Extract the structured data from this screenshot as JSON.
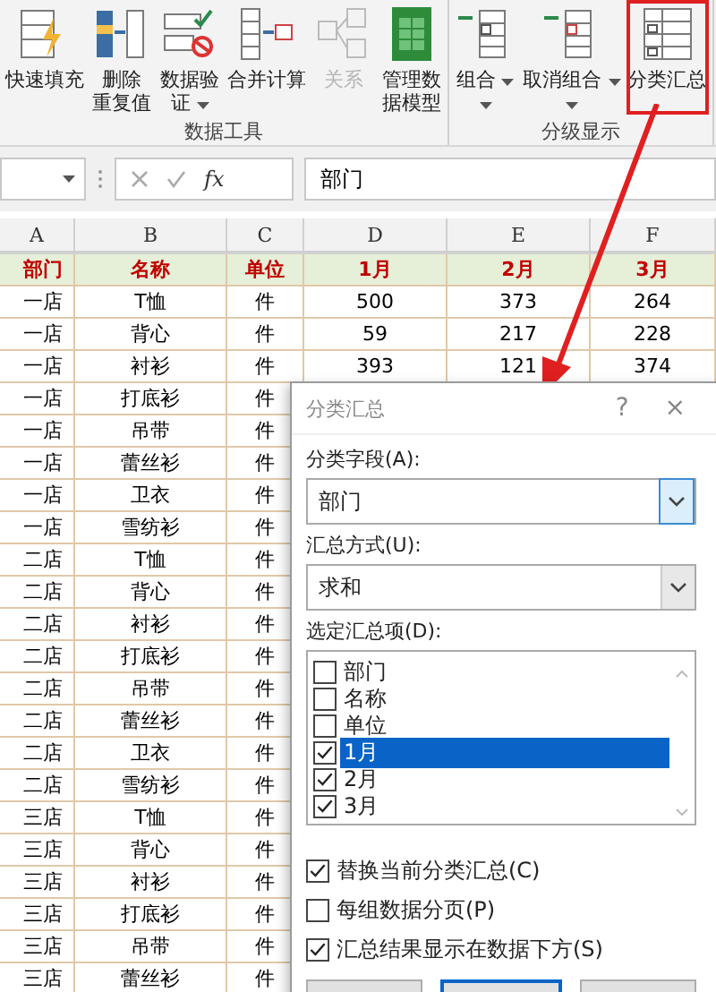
{
  "ribbon": {
    "groups": [
      {
        "label": "数据工具",
        "buttons": [
          {
            "lines": [
              "快速填充"
            ],
            "disabled": false,
            "dropdown": false,
            "annotated": false
          },
          {
            "lines": [
              "删除",
              "重复值"
            ],
            "disabled": false,
            "dropdown": false,
            "annotated": false
          },
          {
            "lines": [
              "数据验",
              "证"
            ],
            "disabled": false,
            "dropdown": true,
            "annotated": false
          },
          {
            "lines": [
              "合并计算"
            ],
            "disabled": false,
            "dropdown": false,
            "annotated": false
          },
          {
            "lines": [
              "关系"
            ],
            "disabled": true,
            "dropdown": false,
            "annotated": false
          },
          {
            "lines": [
              "管理数",
              "据模型"
            ],
            "disabled": false,
            "dropdown": false,
            "annotated": false
          }
        ]
      },
      {
        "label": "分级显示",
        "buttons": [
          {
            "lines": [
              "组合"
            ],
            "disabled": false,
            "dropdown": true,
            "annotated": false
          },
          {
            "lines": [
              "取消组合"
            ],
            "disabled": false,
            "dropdown": true,
            "annotated": false
          },
          {
            "lines": [
              "分类汇总"
            ],
            "disabled": false,
            "dropdown": false,
            "annotated": true
          }
        ]
      }
    ]
  },
  "formula_bar": {
    "function_label": "fx",
    "value": "部门"
  },
  "sheet": {
    "columns": [
      "A",
      "B",
      "C",
      "D",
      "E",
      "F"
    ],
    "header": [
      "部门",
      "名称",
      "单位",
      "1月",
      "2月",
      "3月"
    ],
    "rows": [
      [
        "一店",
        "T恤",
        "件",
        "500",
        "373",
        "264"
      ],
      [
        "一店",
        "背心",
        "件",
        "59",
        "217",
        "228"
      ],
      [
        "一店",
        "衬衫",
        "件",
        "393",
        "121",
        "374"
      ],
      [
        "一店",
        "打底衫",
        "件"
      ],
      [
        "一店",
        "吊带",
        "件"
      ],
      [
        "一店",
        "蕾丝衫",
        "件"
      ],
      [
        "一店",
        "卫衣",
        "件"
      ],
      [
        "一店",
        "雪纺衫",
        "件"
      ],
      [
        "二店",
        "T恤",
        "件"
      ],
      [
        "二店",
        "背心",
        "件"
      ],
      [
        "二店",
        "衬衫",
        "件"
      ],
      [
        "二店",
        "打底衫",
        "件"
      ],
      [
        "二店",
        "吊带",
        "件"
      ],
      [
        "二店",
        "蕾丝衫",
        "件"
      ],
      [
        "二店",
        "卫衣",
        "件"
      ],
      [
        "二店",
        "雪纺衫",
        "件"
      ],
      [
        "三店",
        "T恤",
        "件"
      ],
      [
        "三店",
        "背心",
        "件"
      ],
      [
        "三店",
        "衬衫",
        "件"
      ],
      [
        "三店",
        "打底衫",
        "件"
      ],
      [
        "三店",
        "吊带",
        "件"
      ],
      [
        "三店",
        "蕾丝衫",
        "件"
      ]
    ]
  },
  "dialog": {
    "title": "分类汇总",
    "help": "?",
    "close": "×",
    "selects": [
      {
        "label": "分类字段(A):",
        "value": "部门",
        "focused": true
      },
      {
        "label": "汇总方式(U):",
        "value": "求和",
        "focused": false
      }
    ],
    "list": {
      "label": "选定汇总项(D):",
      "items": [
        {
          "label": "部门",
          "checked": false,
          "selected": false
        },
        {
          "label": "名称",
          "checked": false,
          "selected": false
        },
        {
          "label": "单位",
          "checked": false,
          "selected": false
        },
        {
          "label": "1月",
          "checked": true,
          "selected": true
        },
        {
          "label": "2月",
          "checked": true,
          "selected": false
        },
        {
          "label": "3月",
          "checked": true,
          "selected": false
        }
      ]
    },
    "options": [
      {
        "label": "替换当前分类汇总(C)",
        "checked": true
      },
      {
        "label": "每组数据分页(P)",
        "checked": false
      },
      {
        "label": "汇总结果显示在数据下方(S)",
        "checked": true
      }
    ],
    "buttons": [
      {
        "default": false
      },
      {
        "default": true
      },
      {
        "default": false
      }
    ]
  }
}
